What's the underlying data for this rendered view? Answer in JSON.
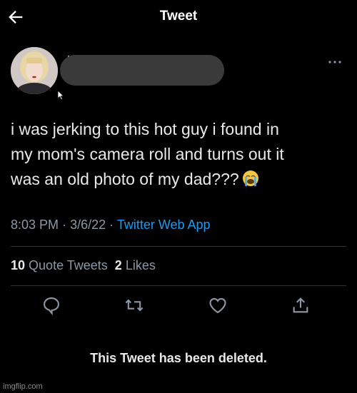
{
  "header": {
    "title": "Tweet"
  },
  "icons": {
    "back": "arrow-left-icon",
    "more": "more-dots-icon",
    "reply": "reply-bubble-icon",
    "retweet": "retweet-icon",
    "like": "heart-icon",
    "share": "share-upload-icon"
  },
  "tweet": {
    "lines": [
      "i was jerking to this hot guy i found in",
      "my mom's camera roll and turns out it",
      "was an old photo of my dad???"
    ],
    "time": "8:03 PM",
    "date": "3/6/22",
    "separator": "·",
    "source": "Twitter Web App"
  },
  "stats": {
    "quote_count": "10",
    "quote_label": "Quote Tweets",
    "like_count": "2",
    "like_label": "Likes"
  },
  "footer": {
    "deleted_text": "This Tweet has been deleted."
  },
  "watermark": "imgflip.com",
  "colors": {
    "background": "#000000",
    "link": "#1d9bf0",
    "muted": "#8b98a5",
    "text": "#e7e9ea"
  }
}
